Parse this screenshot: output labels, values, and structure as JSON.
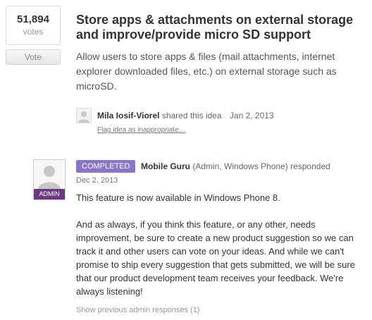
{
  "vote": {
    "count": "51,894",
    "label": "votes",
    "button_label": "Vote"
  },
  "idea": {
    "title": "Store apps & attachments on external storage and improve/provide micro SD support",
    "description": "Allow users to store apps & files (mail attachments, internet explorer downloaded files, etc.) on external storage such as microSD.",
    "author": "Mila Iosif-Viorel",
    "shared_text": "shared this idea",
    "date": "Jan 2, 2013",
    "flag_link": "Flag idea as inappropriate…"
  },
  "response": {
    "avatar_badge": "ADMIN",
    "status": "COMPLETED",
    "responder": "Mobile Guru",
    "responder_role": "(Admin, Windows Phone)",
    "responded_text": "responded",
    "date": "Dec 2, 2013",
    "paragraphs": [
      "This feature is now available in Windows Phone 8.",
      "And as always, if you think this feature, or any other, needs improvement, be sure to create a new product suggestion so we can track it and other users can vote on your ideas. And while we can't promise to ship every suggestion that gets submitted, we will be sure that our product development team receives your feedback. We're always listening!"
    ],
    "show_previous": "Show previous admin responses (1)"
  }
}
